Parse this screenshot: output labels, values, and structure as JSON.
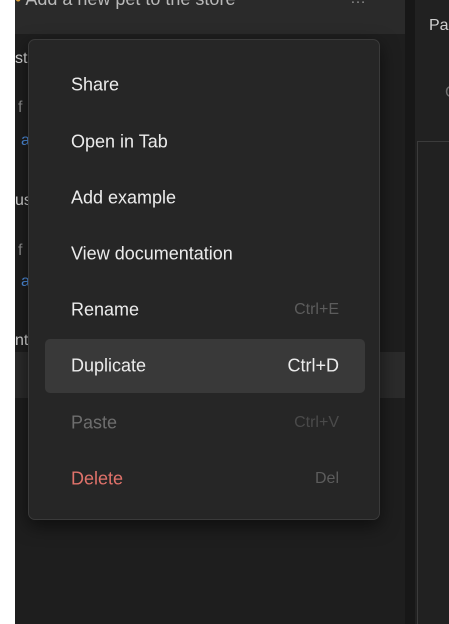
{
  "top_strip": {
    "title": "Add a new pet to the store",
    "more": "…"
  },
  "sidebar_fragments": [
    "st",
    "f",
    "a",
    "us",
    "f",
    "a",
    "nt"
  ],
  "right_pane": {
    "label": "Pa",
    "faint": "C"
  },
  "context_menu": {
    "items": [
      {
        "label": "Share",
        "shortcut": ""
      },
      {
        "label": "Open in Tab",
        "shortcut": ""
      },
      {
        "label": "Add example",
        "shortcut": ""
      },
      {
        "label": "View documentation",
        "shortcut": ""
      },
      {
        "label": "Rename",
        "shortcut": "Ctrl+E"
      },
      {
        "label": "Duplicate",
        "shortcut": "Ctrl+D",
        "state": "highlighted"
      },
      {
        "label": "Paste",
        "shortcut": "Ctrl+V",
        "state": "disabled"
      },
      {
        "label": "Delete",
        "shortcut": "Del",
        "state": "danger"
      }
    ]
  },
  "colors": {
    "menu_bg": "#262626",
    "highlight_bg": "#393939",
    "danger_text": "#e0726a",
    "disabled_text": "#6e6e6e",
    "link_blue": "#4f8fe0"
  }
}
